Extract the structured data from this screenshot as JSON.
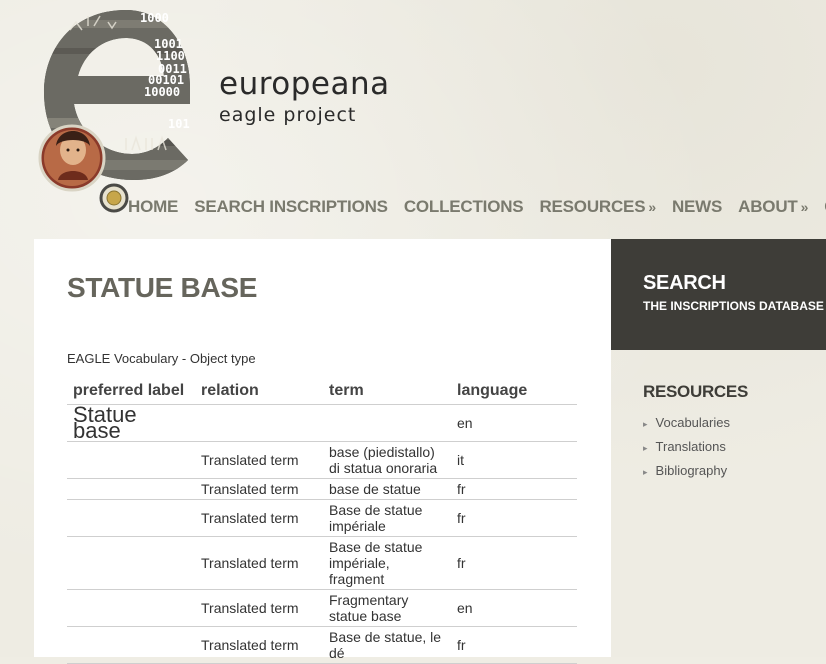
{
  "brand": {
    "name": "europeana",
    "sub": "eagle project"
  },
  "logo_digits": [
    "1000",
    "1001",
    "1100",
    "0011",
    "00101",
    "10000",
    "101"
  ],
  "nav": {
    "items": [
      {
        "label": "HOME",
        "dropdown": false
      },
      {
        "label": "SEARCH INSCRIPTIONS",
        "dropdown": false
      },
      {
        "label": "COLLECTIONS",
        "dropdown": false
      },
      {
        "label": "RESOURCES",
        "dropdown": true
      },
      {
        "label": "NEWS",
        "dropdown": false
      },
      {
        "label": "ABOUT",
        "dropdown": true
      },
      {
        "label": "CO",
        "dropdown": false
      }
    ],
    "dropdown_glyph": "»"
  },
  "main": {
    "title": "STATUE BASE",
    "vocabulary_label": "EAGLE Vocabulary - Object type",
    "table": {
      "headers": [
        "preferred label",
        "relation",
        "term",
        "language"
      ],
      "rows": [
        {
          "preferred": "Statue base",
          "relation": "",
          "term": "",
          "language": "en"
        },
        {
          "preferred": "",
          "relation": "Translated term",
          "term": "base (piedistallo) di statua onoraria",
          "language": "it"
        },
        {
          "preferred": "",
          "relation": "Translated term",
          "term": "base de statue",
          "language": "fr"
        },
        {
          "preferred": "",
          "relation": "Translated term",
          "term": "Base de statue impériale",
          "language": "fr"
        },
        {
          "preferred": "",
          "relation": "Translated term",
          "term": "Base de statue impériale, fragment",
          "language": "fr"
        },
        {
          "preferred": "",
          "relation": "Translated term",
          "term": "Fragmentary statue base",
          "language": "en"
        },
        {
          "preferred": "",
          "relation": "Translated term",
          "term": "Base de statue, le dé",
          "language": "fr"
        }
      ]
    }
  },
  "sidebar": {
    "search_title": "SEARCH",
    "search_subtitle": "THE INSCRIPTIONS DATABASE",
    "resources_title": "RESOURCES",
    "resources": [
      "Vocabularies",
      "Translations",
      "Bibliography"
    ]
  },
  "colors": {
    "nav_text": "#7a7a6e",
    "search_box_bg": "#3e3d38",
    "title_text": "#66655c"
  }
}
